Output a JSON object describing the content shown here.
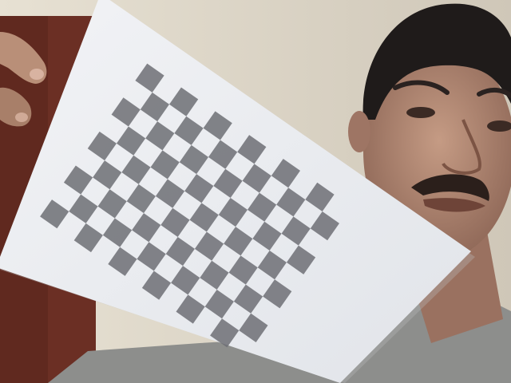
{
  "scene": {
    "description_objects": [
      "wall",
      "door-frame",
      "person",
      "calibration-sheet",
      "hand"
    ],
    "colors": {
      "wall": "#d9d3c6",
      "door_frame": "#6b2f24",
      "paper": "#eef0f3",
      "checker_square": "#6d6f74",
      "skin": "#b98f78",
      "hair": "#1f1b1a",
      "shirt": "#8d8e8c"
    },
    "checkerboard": {
      "pattern": "checkerboard"
    }
  }
}
